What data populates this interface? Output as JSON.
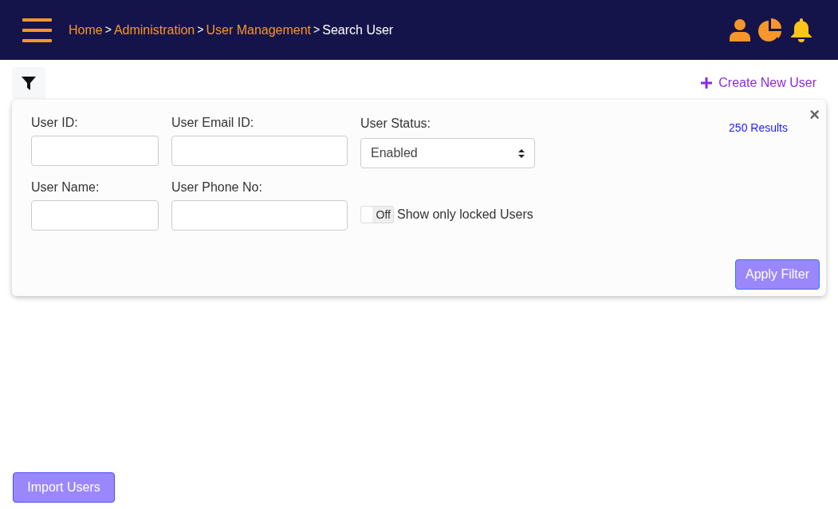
{
  "breadcrumb": [
    {
      "label": "Home",
      "current": false
    },
    {
      "label": "Administration",
      "current": false
    },
    {
      "label": "User Management",
      "current": false
    },
    {
      "label": "Search User",
      "current": true
    }
  ],
  "breadcrumb_separator": ">",
  "create_button": {
    "label": "Create New User"
  },
  "filter_panel": {
    "results": "250 Results",
    "close": "×",
    "fields": [
      {
        "kind": "text",
        "label": "User ID:"
      },
      {
        "kind": "text",
        "label": "User Email ID:"
      },
      {
        "kind": "select",
        "label": "User Status:",
        "value": "Enabled"
      },
      {
        "kind": "text",
        "label": "User Name:"
      },
      {
        "kind": "text",
        "label": "User Phone No:"
      },
      {
        "kind": "toggle",
        "state_text": "Off",
        "on": false,
        "caption": "Show only locked Users"
      }
    ],
    "apply_button": "Apply Filter"
  },
  "import_button": "Import Users"
}
